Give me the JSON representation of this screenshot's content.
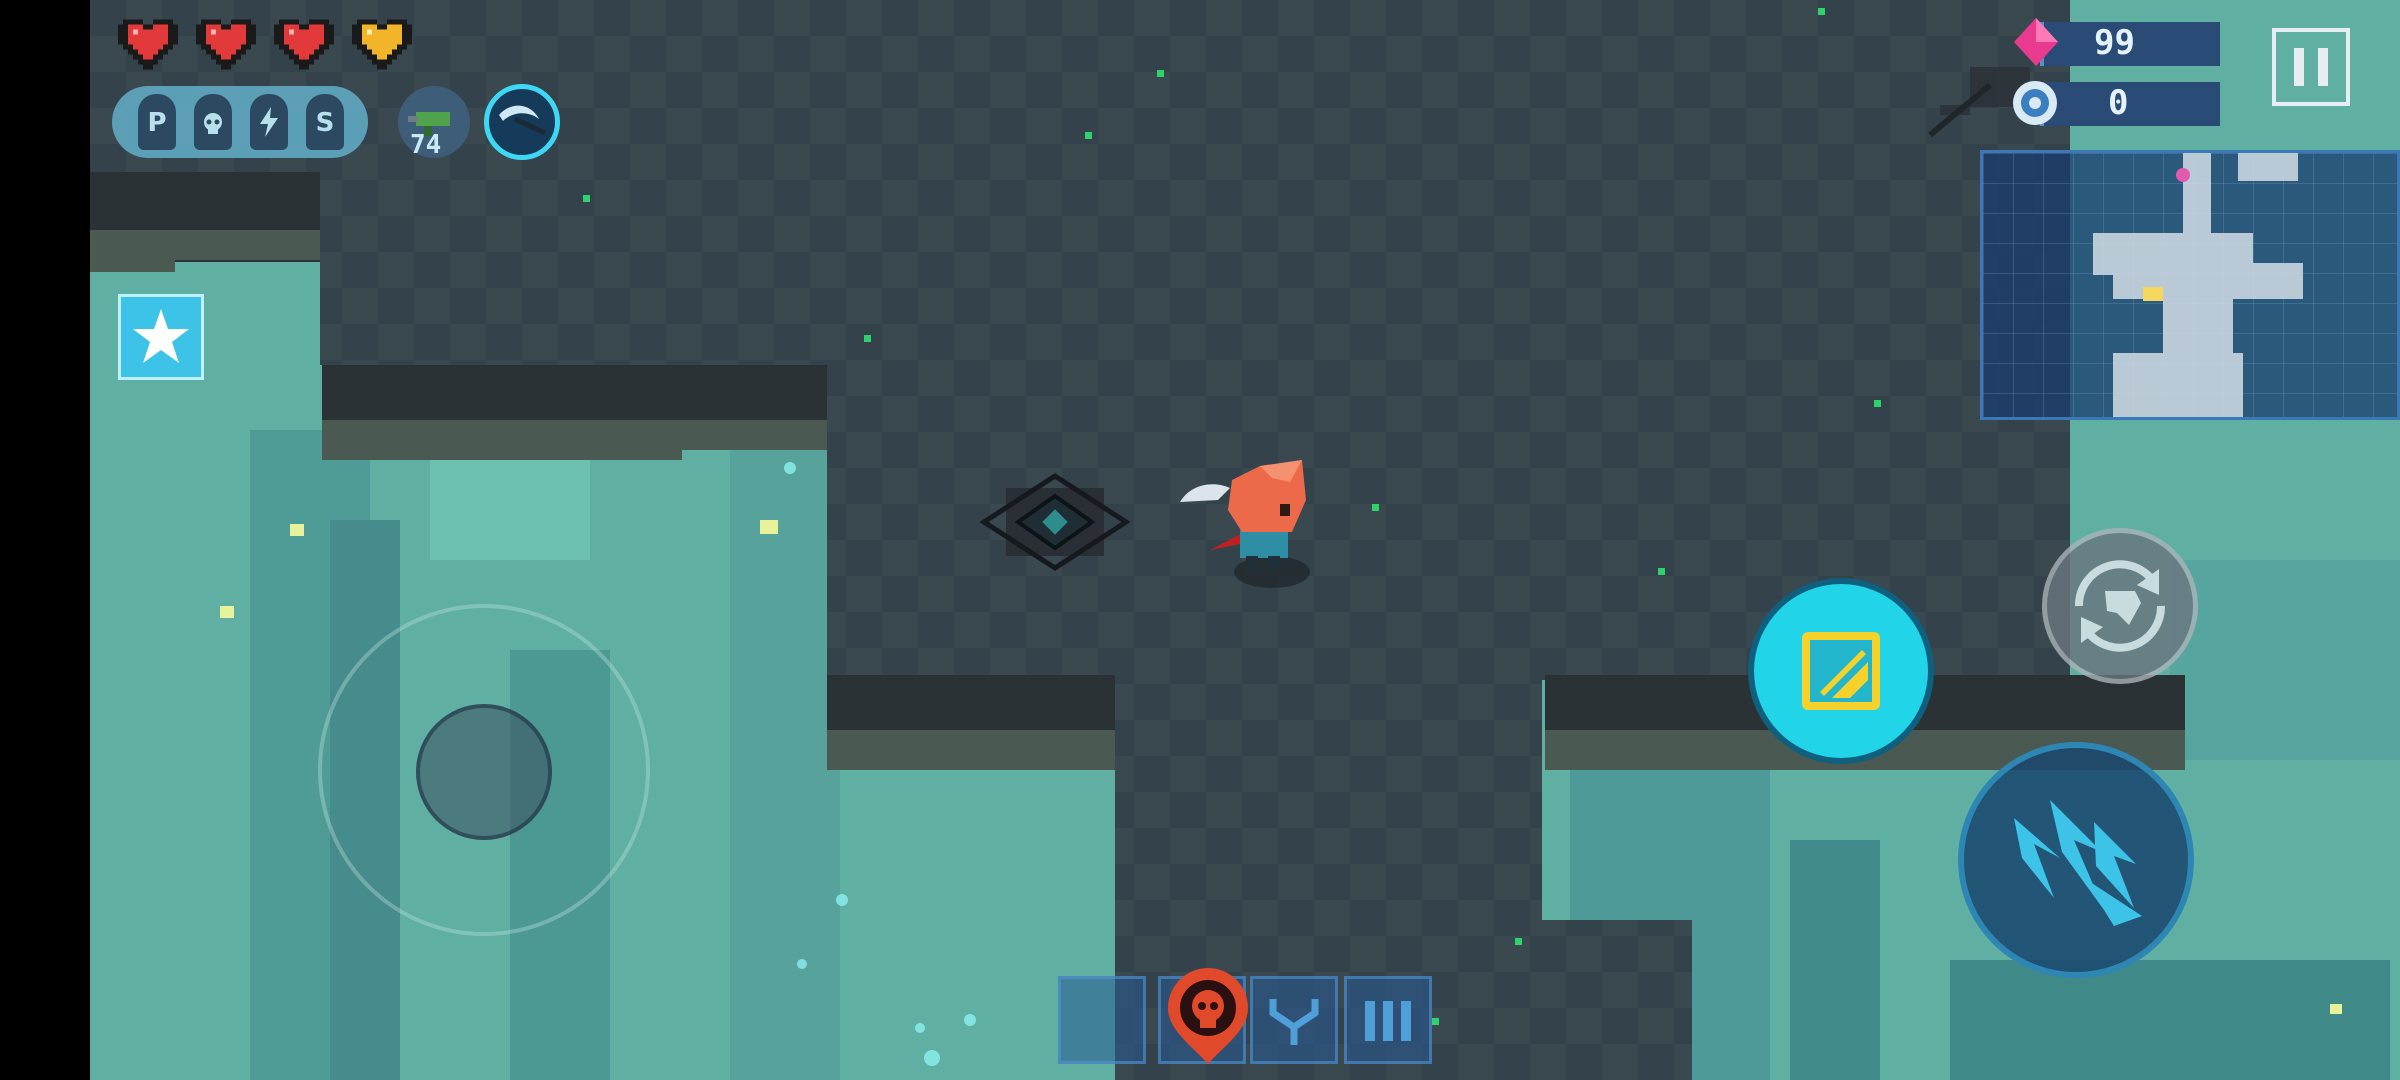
{
  "hud": {
    "hearts": [
      {
        "name": "health-heart-1",
        "color": "#e23a3a",
        "state": "full"
      },
      {
        "name": "health-heart-2",
        "color": "#e23a3a",
        "state": "full"
      },
      {
        "name": "health-heart-3",
        "color": "#e23a3a",
        "state": "full"
      },
      {
        "name": "armor-heart",
        "color": "#f2b52a",
        "state": "full"
      }
    ],
    "buff_slots": [
      "P",
      "",
      "",
      "S"
    ],
    "buff_icons": [
      "",
      "skull-icon",
      "lightning-icon",
      ""
    ],
    "weapon_ammo": "74",
    "gems": "99",
    "parts": "0",
    "accent": "#22d4e8"
  },
  "icons": {
    "gem": "diamond-icon",
    "parts": "gear-icon",
    "pause": "pause-icon",
    "skill": "sword-skill-icon",
    "swap": "weapon-swap-icon",
    "attack": "attack-claw-icon",
    "boss": "skull-marker-icon",
    "star": "star-icon"
  }
}
